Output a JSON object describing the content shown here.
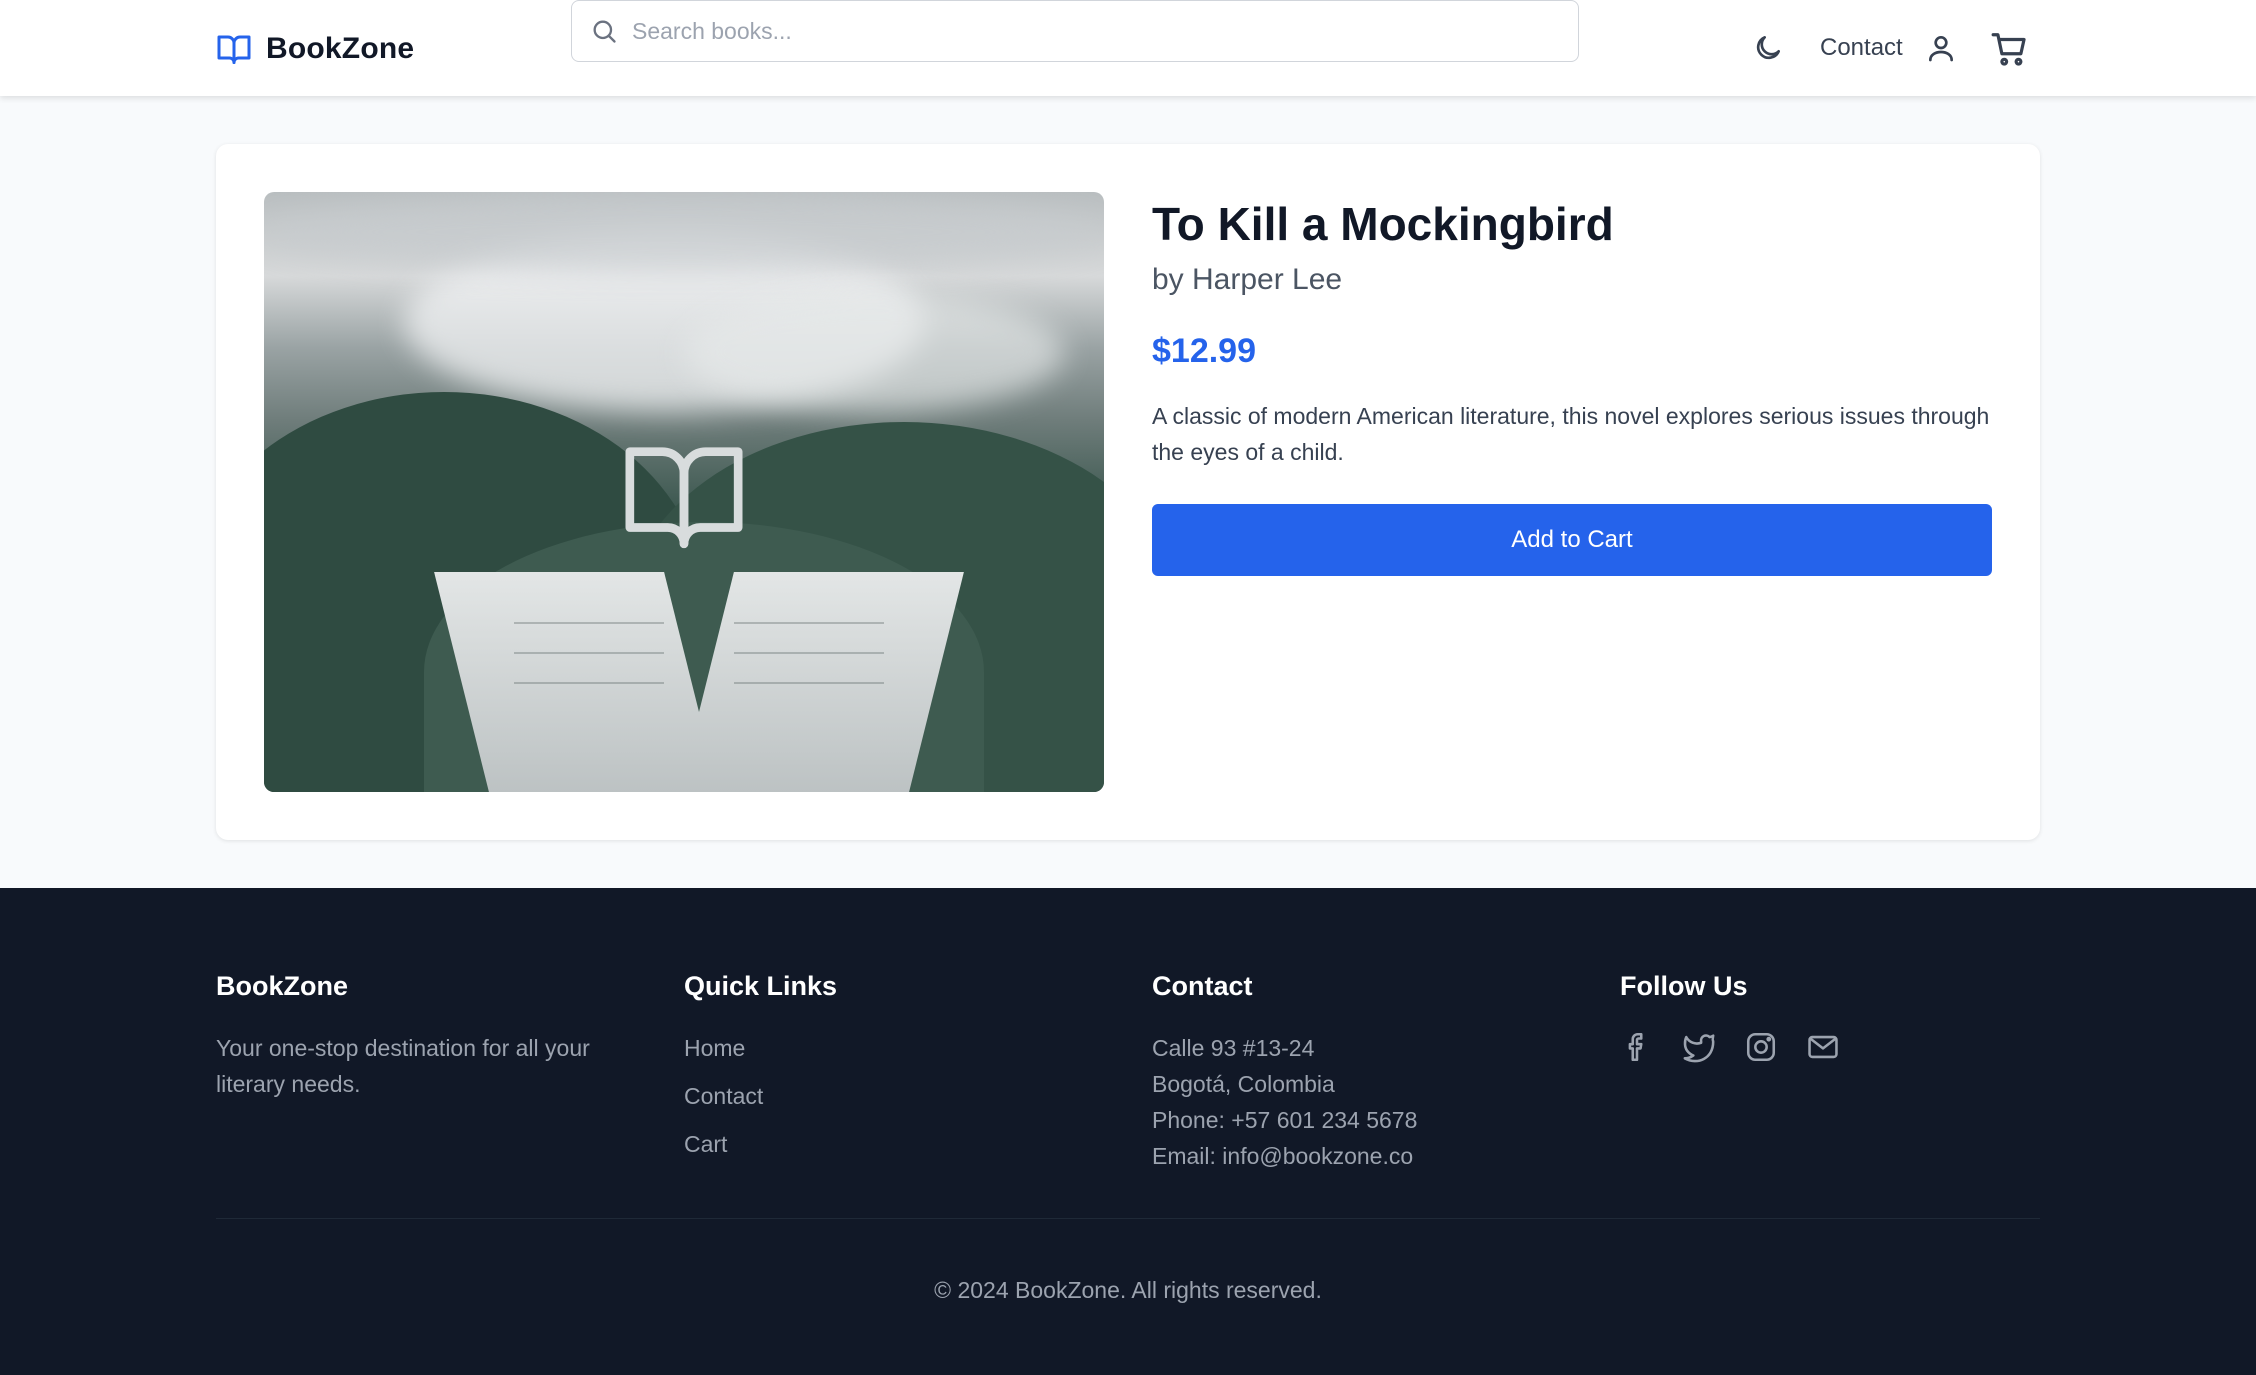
{
  "header": {
    "brand": "BookZone",
    "search": {
      "placeholder": "Search books...",
      "value": ""
    },
    "nav": {
      "contact_label": "Contact"
    },
    "icons": [
      "book-open-icon",
      "search-icon",
      "moon-icon",
      "user-icon",
      "cart-icon"
    ]
  },
  "product": {
    "title": "To Kill a Mockingbird",
    "author": "by Harper Lee",
    "price": "$12.99",
    "description": "A classic of modern American literature, this novel explores serious issues through the eyes of a child.",
    "add_to_cart_label": "Add to Cart"
  },
  "footer": {
    "about": {
      "heading": "BookZone",
      "text": "Your one-stop destination for all your literary needs."
    },
    "quick_links": {
      "heading": "Quick Links",
      "items": [
        "Home",
        "Contact",
        "Cart"
      ]
    },
    "contact": {
      "heading": "Contact",
      "address_line1": "Calle 93 #13-24",
      "address_line2": "Bogotá, Colombia",
      "phone": "Phone: +57 601 234 5678",
      "email": "Email: info@bookzone.co"
    },
    "follow": {
      "heading": "Follow Us",
      "icons": [
        "facebook-icon",
        "twitter-icon",
        "instagram-icon",
        "mail-icon"
      ]
    },
    "copyright": "© 2024 BookZone. All rights reserved."
  },
  "colors": {
    "accent": "#2563eb",
    "footer_bg": "#111827",
    "page_bg": "#f8fafc"
  }
}
